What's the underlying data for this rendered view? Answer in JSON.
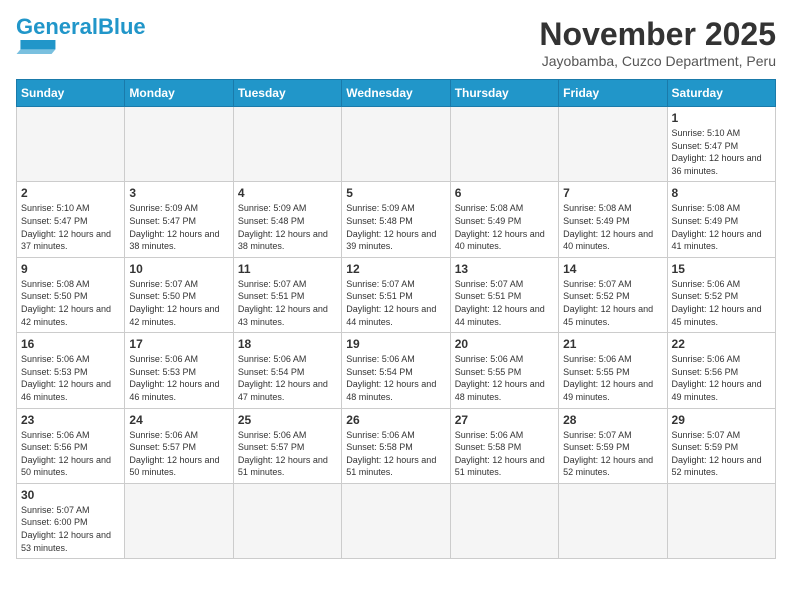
{
  "header": {
    "logo_general": "General",
    "logo_blue": "Blue",
    "month_title": "November 2025",
    "subtitle": "Jayobamba, Cuzco Department, Peru"
  },
  "weekdays": [
    "Sunday",
    "Monday",
    "Tuesday",
    "Wednesday",
    "Thursday",
    "Friday",
    "Saturday"
  ],
  "days": [
    {
      "date": "",
      "empty": true
    },
    {
      "date": "",
      "empty": true
    },
    {
      "date": "",
      "empty": true
    },
    {
      "date": "",
      "empty": true
    },
    {
      "date": "",
      "empty": true
    },
    {
      "date": "",
      "empty": true
    },
    {
      "date": "1",
      "sunrise": "5:10 AM",
      "sunset": "5:47 PM",
      "daylight": "12 hours and 36 minutes."
    },
    {
      "date": "2",
      "sunrise": "5:10 AM",
      "sunset": "5:47 PM",
      "daylight": "12 hours and 37 minutes."
    },
    {
      "date": "3",
      "sunrise": "5:09 AM",
      "sunset": "5:47 PM",
      "daylight": "12 hours and 38 minutes."
    },
    {
      "date": "4",
      "sunrise": "5:09 AM",
      "sunset": "5:48 PM",
      "daylight": "12 hours and 38 minutes."
    },
    {
      "date": "5",
      "sunrise": "5:09 AM",
      "sunset": "5:48 PM",
      "daylight": "12 hours and 39 minutes."
    },
    {
      "date": "6",
      "sunrise": "5:08 AM",
      "sunset": "5:49 PM",
      "daylight": "12 hours and 40 minutes."
    },
    {
      "date": "7",
      "sunrise": "5:08 AM",
      "sunset": "5:49 PM",
      "daylight": "12 hours and 40 minutes."
    },
    {
      "date": "8",
      "sunrise": "5:08 AM",
      "sunset": "5:49 PM",
      "daylight": "12 hours and 41 minutes."
    },
    {
      "date": "9",
      "sunrise": "5:08 AM",
      "sunset": "5:50 PM",
      "daylight": "12 hours and 42 minutes."
    },
    {
      "date": "10",
      "sunrise": "5:07 AM",
      "sunset": "5:50 PM",
      "daylight": "12 hours and 42 minutes."
    },
    {
      "date": "11",
      "sunrise": "5:07 AM",
      "sunset": "5:51 PM",
      "daylight": "12 hours and 43 minutes."
    },
    {
      "date": "12",
      "sunrise": "5:07 AM",
      "sunset": "5:51 PM",
      "daylight": "12 hours and 44 minutes."
    },
    {
      "date": "13",
      "sunrise": "5:07 AM",
      "sunset": "5:51 PM",
      "daylight": "12 hours and 44 minutes."
    },
    {
      "date": "14",
      "sunrise": "5:07 AM",
      "sunset": "5:52 PM",
      "daylight": "12 hours and 45 minutes."
    },
    {
      "date": "15",
      "sunrise": "5:06 AM",
      "sunset": "5:52 PM",
      "daylight": "12 hours and 45 minutes."
    },
    {
      "date": "16",
      "sunrise": "5:06 AM",
      "sunset": "5:53 PM",
      "daylight": "12 hours and 46 minutes."
    },
    {
      "date": "17",
      "sunrise": "5:06 AM",
      "sunset": "5:53 PM",
      "daylight": "12 hours and 46 minutes."
    },
    {
      "date": "18",
      "sunrise": "5:06 AM",
      "sunset": "5:54 PM",
      "daylight": "12 hours and 47 minutes."
    },
    {
      "date": "19",
      "sunrise": "5:06 AM",
      "sunset": "5:54 PM",
      "daylight": "12 hours and 48 minutes."
    },
    {
      "date": "20",
      "sunrise": "5:06 AM",
      "sunset": "5:55 PM",
      "daylight": "12 hours and 48 minutes."
    },
    {
      "date": "21",
      "sunrise": "5:06 AM",
      "sunset": "5:55 PM",
      "daylight": "12 hours and 49 minutes."
    },
    {
      "date": "22",
      "sunrise": "5:06 AM",
      "sunset": "5:56 PM",
      "daylight": "12 hours and 49 minutes."
    },
    {
      "date": "23",
      "sunrise": "5:06 AM",
      "sunset": "5:56 PM",
      "daylight": "12 hours and 50 minutes."
    },
    {
      "date": "24",
      "sunrise": "5:06 AM",
      "sunset": "5:57 PM",
      "daylight": "12 hours and 50 minutes."
    },
    {
      "date": "25",
      "sunrise": "5:06 AM",
      "sunset": "5:57 PM",
      "daylight": "12 hours and 51 minutes."
    },
    {
      "date": "26",
      "sunrise": "5:06 AM",
      "sunset": "5:58 PM",
      "daylight": "12 hours and 51 minutes."
    },
    {
      "date": "27",
      "sunrise": "5:06 AM",
      "sunset": "5:58 PM",
      "daylight": "12 hours and 51 minutes."
    },
    {
      "date": "28",
      "sunrise": "5:07 AM",
      "sunset": "5:59 PM",
      "daylight": "12 hours and 52 minutes."
    },
    {
      "date": "29",
      "sunrise": "5:07 AM",
      "sunset": "5:59 PM",
      "daylight": "12 hours and 52 minutes."
    },
    {
      "date": "30",
      "sunrise": "5:07 AM",
      "sunset": "6:00 PM",
      "daylight": "12 hours and 53 minutes."
    }
  ],
  "labels": {
    "sunrise": "Sunrise:",
    "sunset": "Sunset:",
    "daylight": "Daylight:"
  },
  "colors": {
    "header_bg": "#2196c9",
    "logo_blue": "#2196c9"
  }
}
